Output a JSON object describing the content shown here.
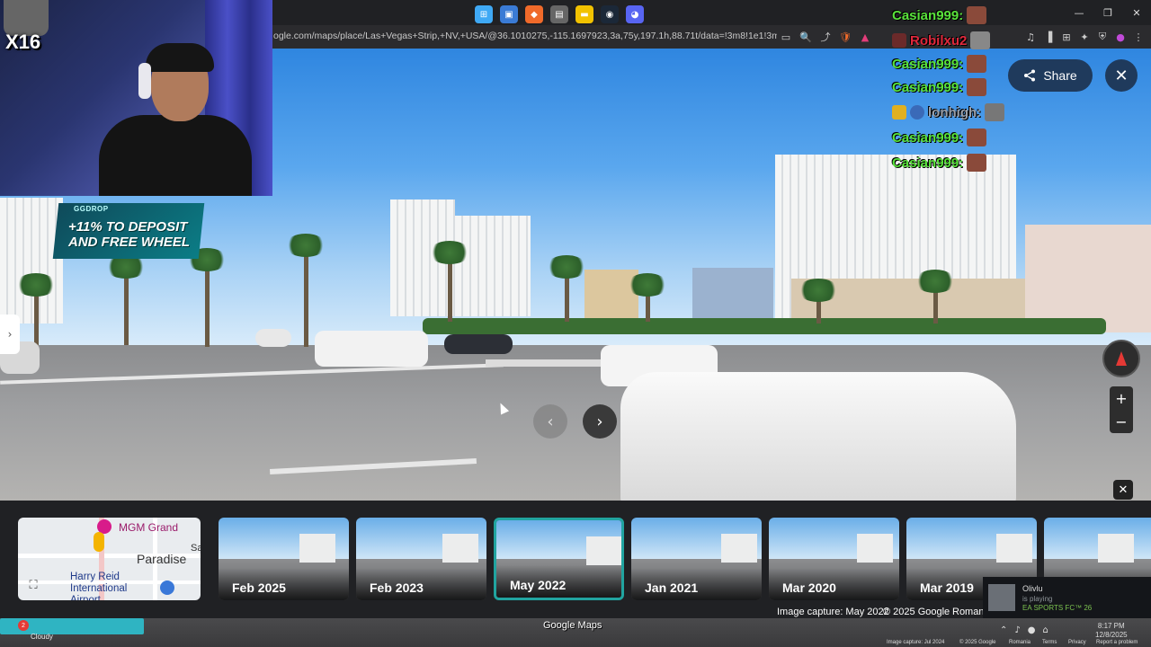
{
  "browser": {
    "url": "ogle.com/maps/place/Las+Vegas+Strip,+NV,+USA/@36.1010275,-115.1697923,3a,75y,197.1h,88.71t/data=!3m8!1e1!3m6!1sFuFFV8Tcu...",
    "window_controls": [
      "—",
      "❐",
      "✕"
    ],
    "address_icons": [
      "▭",
      "🔍",
      "⤴",
      "🛡",
      "▲"
    ],
    "extension_icons": [
      "♫",
      "▐",
      "⊞",
      "✦",
      "⛨",
      "●",
      "⋮"
    ]
  },
  "streetview": {
    "share_label": "Share",
    "share_icon": "share-icon",
    "close_label": "✕",
    "back_label": "›",
    "prev_label": "‹",
    "next_label": "›",
    "zoom_in": "+",
    "zoom_out": "−",
    "timeline_close": "✕"
  },
  "stream": {
    "multiplier": "X16",
    "promo_brand": "GGDROP",
    "promo_text": "+11% TO DEPOSIT AND FREE WHEEL"
  },
  "chat": [
    {
      "name": "Casian999:",
      "color": "#59e33b"
    },
    {
      "name": "Robilxu2",
      "color": "#e0283c"
    },
    {
      "name": "Casian999:",
      "color": "#59e33b"
    },
    {
      "name": "Casian999:",
      "color": "#59e33b"
    },
    {
      "name": "lonhigh:",
      "color": "#9aa0aa"
    },
    {
      "name": "Casian999:",
      "color": "#59e33b"
    },
    {
      "name": "Casian999:",
      "color": "#59e33b"
    }
  ],
  "minimap": {
    "label_mgm": "MGM Grand",
    "label_paradise": "Paradise",
    "label_airport": "Harry Reid International Airport",
    "label_sa": "Sa"
  },
  "timeline": [
    {
      "date": "Feb 2025",
      "selected": false
    },
    {
      "date": "Feb 2023",
      "selected": false
    },
    {
      "date": "May 2022",
      "selected": true
    },
    {
      "date": "Jan 2021",
      "selected": false
    },
    {
      "date": "Mar 2020",
      "selected": false
    },
    {
      "date": "Mar 2019",
      "selected": false
    },
    {
      "date": "",
      "selected": false
    }
  ],
  "captions": {
    "image_capture": "Image capture: May 2022",
    "copyright": "© 2025 Google",
    "region": "Romani"
  },
  "notification": {
    "name": "Olivlu",
    "status": "is playing",
    "game": "EA SPORTS FC™ 26"
  },
  "taskbar": {
    "tooltip": "Google Maps",
    "clock_time": "8:17 PM",
    "clock_date": "12/8/2025",
    "bottom_capture": "Image capture: Jul 2024",
    "bottom_copyright": "© 2025 Google",
    "bottom_links": [
      "Romania",
      "Terms",
      "Privacy",
      "Report a problem"
    ],
    "weather_badge": "2",
    "weather_label": "Cloudy"
  }
}
